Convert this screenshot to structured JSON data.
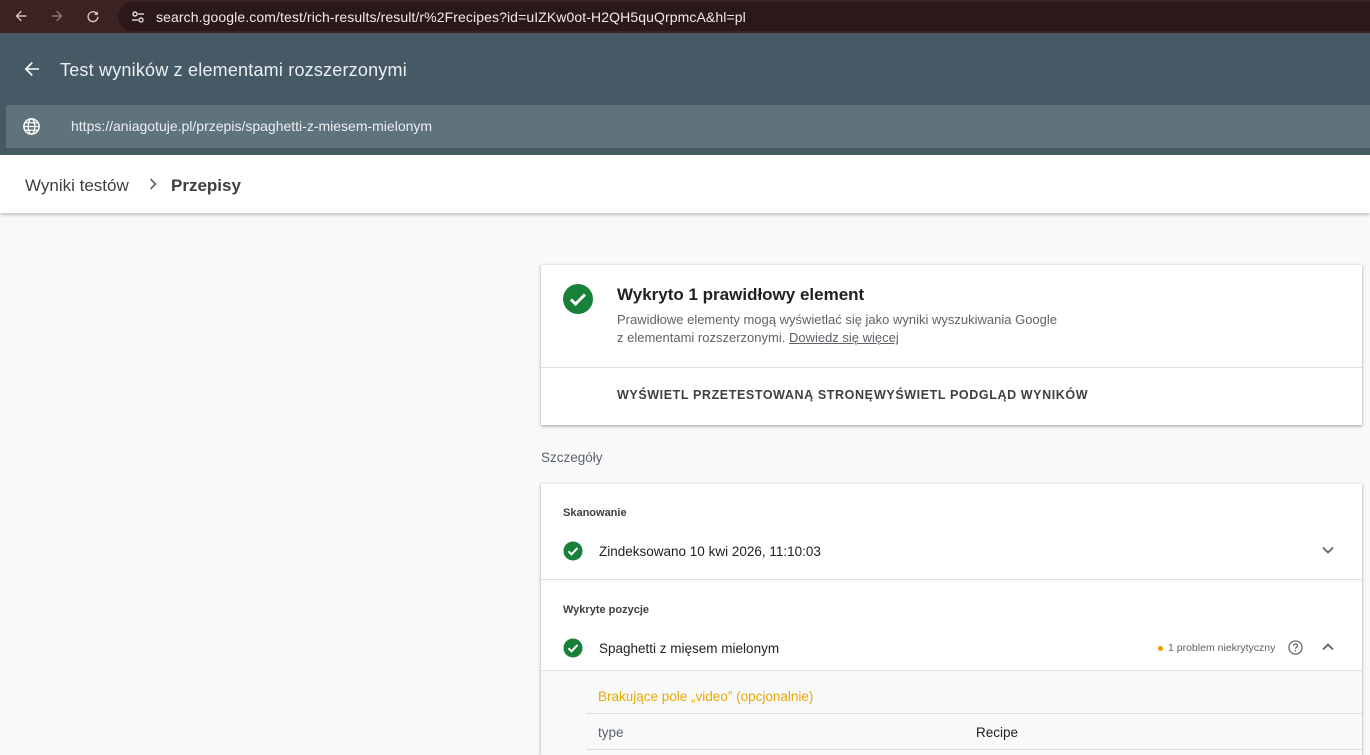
{
  "browser": {
    "url": "search.google.com/test/rich-results/result/r%2Frecipes?id=uIZKw0ot-H2QH5quQrpmcA&hl=pl"
  },
  "app": {
    "title": "Test wyników z elementami rozszerzonymi",
    "tested_url": "https://aniagotuje.pl/przepis/spaghetti-z-miesem-mielonym"
  },
  "breadcrumb": {
    "parent": "Wyniki testów",
    "current": "Przepisy"
  },
  "summary": {
    "title": "Wykryto 1 prawidłowy element",
    "desc_line1": "Prawidłowe elementy mogą wyświetlać się jako wyniki wyszukiwania Google",
    "desc_line2": "z elementami rozszerzonymi.",
    "learn_more": "Dowiedz się więcej",
    "btn_tested_page": "WYŚWIETL PRZETESTOWANĄ STRONĘ",
    "btn_preview": "WYŚWIETL PODGLĄD WYNIKÓW"
  },
  "details": {
    "label": "Szczegóły",
    "crawl": {
      "label": "Skanowanie",
      "status": "Zindeksowano 10 kwi 2026, 11:10:03"
    },
    "detected": {
      "label": "Wykryte pozycje",
      "item": "Spaghetti z mięsem mielonym",
      "issues": "1 problem niekrytyczny",
      "missing_field": "Brakujące pole „video” (opcjonalnie)",
      "property_key": "type",
      "property_value": "Recipe"
    }
  },
  "colors": {
    "success": "#188038",
    "warning": "#f29900",
    "header": "#455a64"
  }
}
